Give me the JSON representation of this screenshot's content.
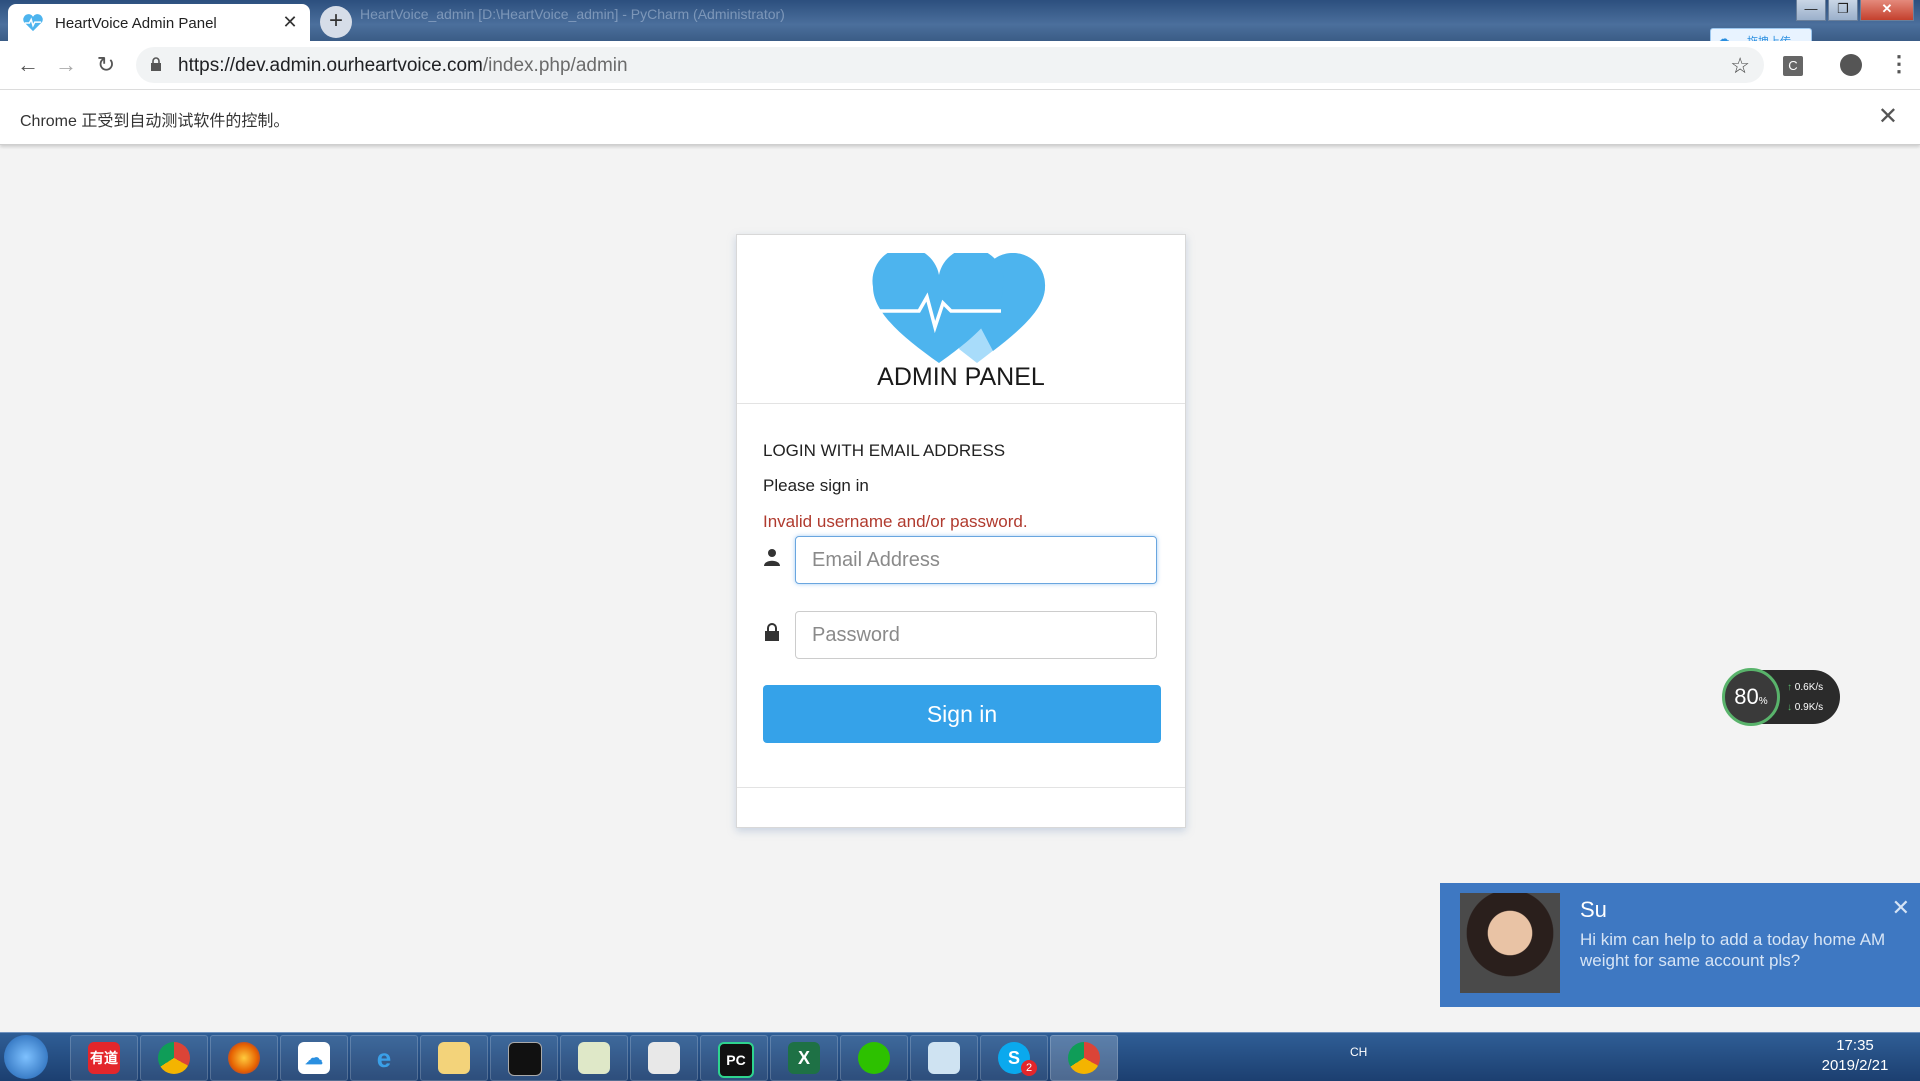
{
  "browser": {
    "tab_title": "HeartVoice Admin Panel",
    "new_tab_label": "+",
    "tab_close": "✕",
    "background_window_title": "HeartVoice_admin [D:\\HeartVoice_admin] - PyCharm (Administrator)",
    "url_host": "https://dev.admin.ourheartvoice.com",
    "url_path": "/index.php/admin",
    "extension_label": "C",
    "baidu_upload": "拖拽上传",
    "infobar_message": "Chrome 正受到自动测试软件的控制。",
    "infobar_close": "✕",
    "window_buttons": {
      "min": "—",
      "max": "❐",
      "close": "✕"
    }
  },
  "login": {
    "panel_title": "ADMIN PANEL",
    "heading": "LOGIN WITH EMAIL ADDRESS",
    "subheading": "Please sign in",
    "error": "Invalid username and/or password.",
    "email_placeholder": "Email Address",
    "email_value": "",
    "password_placeholder": "Password",
    "password_value": "",
    "submit_label": "Sign in",
    "colors": {
      "accent": "#35a2e9",
      "error": "#b03a2e",
      "logo": "#4db4ee"
    }
  },
  "net_widget": {
    "percent": "80",
    "percent_unit": "%",
    "upload": "0.6",
    "download": "0.9",
    "unit": "K/s"
  },
  "notification": {
    "sender": "Su",
    "message": "Hi kim can help to add a today home AM weight for same account pls?",
    "close": "✕"
  },
  "taskbar": {
    "apps": [
      "start-icon",
      "youdao-icon",
      "chrome-icon",
      "firefox-icon",
      "baidu-netdisk-icon",
      "ie-icon",
      "explorer-icon",
      "cmd-icon",
      "notepad-icon",
      "kindle-icon",
      "pycharm-icon",
      "excel-icon",
      "wechat-icon",
      "notebook-icon",
      "skype-icon",
      "chrome-active-icon"
    ],
    "youdao_label": "有道",
    "pycharm_label": "PC",
    "excel_label": "X",
    "skype_label": "S",
    "skype_badge": "2",
    "lang": "CH",
    "time": "17:35",
    "date": "2019/2/21"
  }
}
